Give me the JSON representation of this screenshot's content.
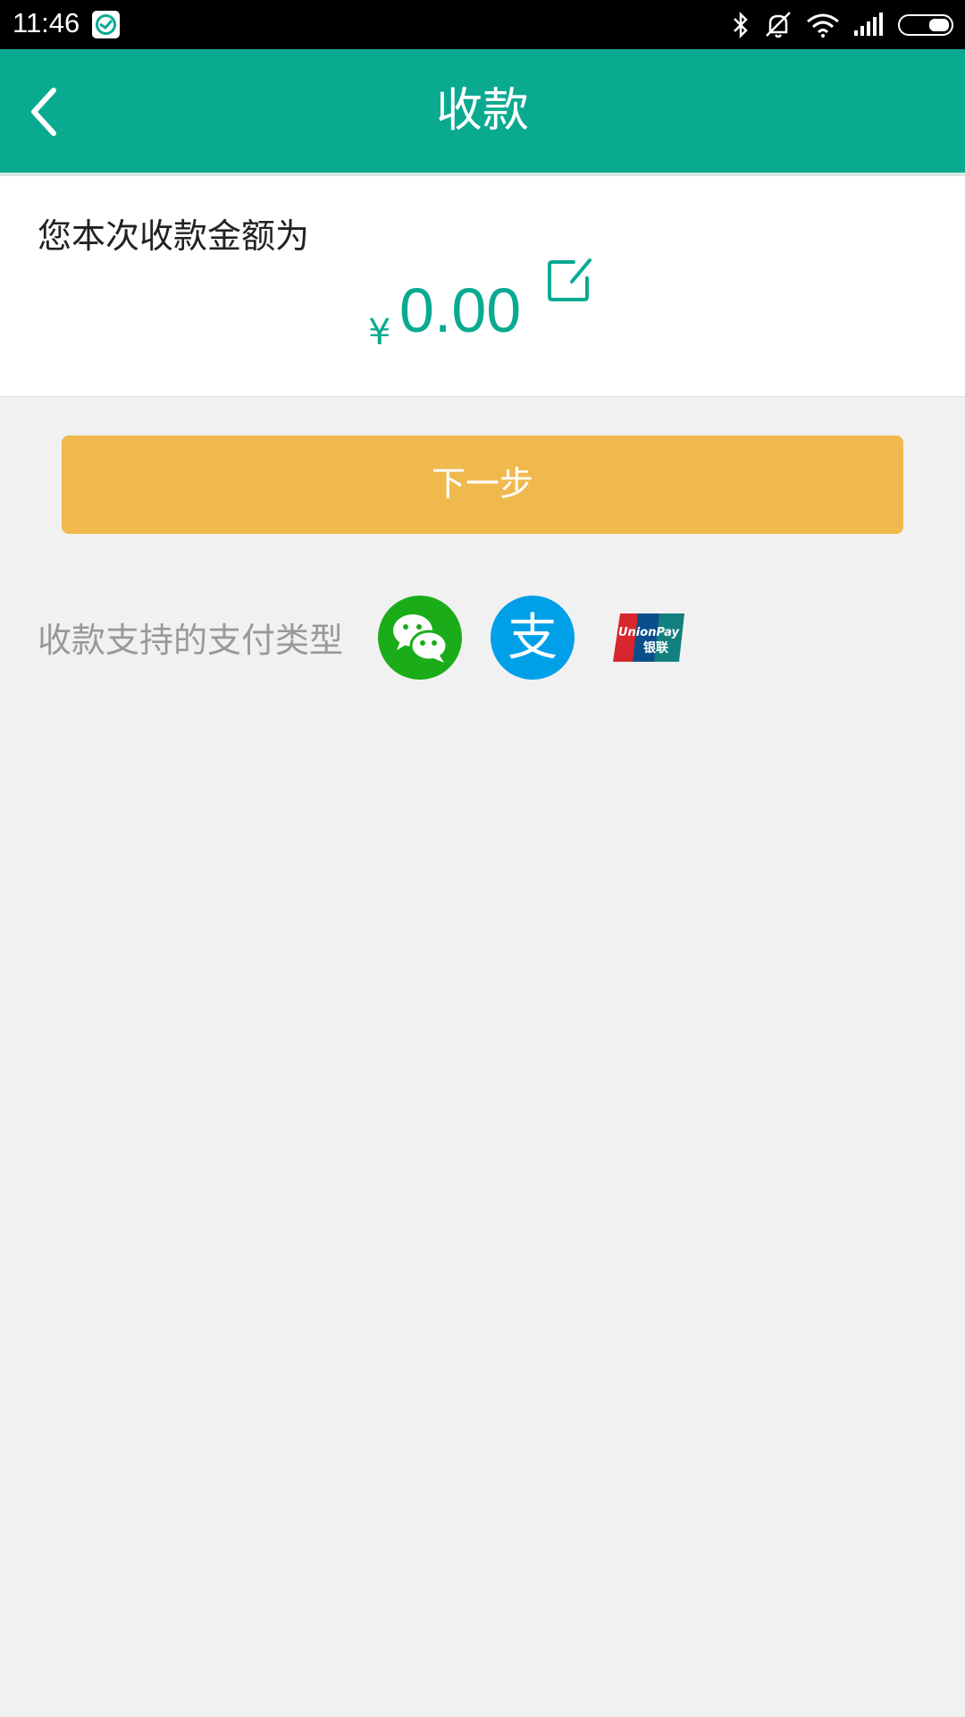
{
  "status_bar": {
    "time": "11:46",
    "icons": [
      "app-icon",
      "bluetooth-icon",
      "mute-icon",
      "wifi-icon",
      "signal-icon",
      "battery-icon"
    ]
  },
  "header": {
    "title": "收款",
    "back_icon": "chevron-left-icon",
    "background_color": "#0aaa91"
  },
  "amount": {
    "label": "您本次收款金额为",
    "currency_symbol": "¥",
    "value": "0.00",
    "edit_icon": "edit-icon",
    "color": "#0aaa91"
  },
  "next_button": {
    "label": "下一步",
    "color": "#f0b94e"
  },
  "payment_types": {
    "label": "收款支持的支付类型",
    "methods": [
      {
        "name": "wechat-pay-icon",
        "color": "#1aad19"
      },
      {
        "name": "alipay-icon",
        "color": "#00a0e9",
        "glyph": "支"
      },
      {
        "name": "unionpay-icon",
        "logo_text": "UnionPay 银联"
      }
    ]
  }
}
